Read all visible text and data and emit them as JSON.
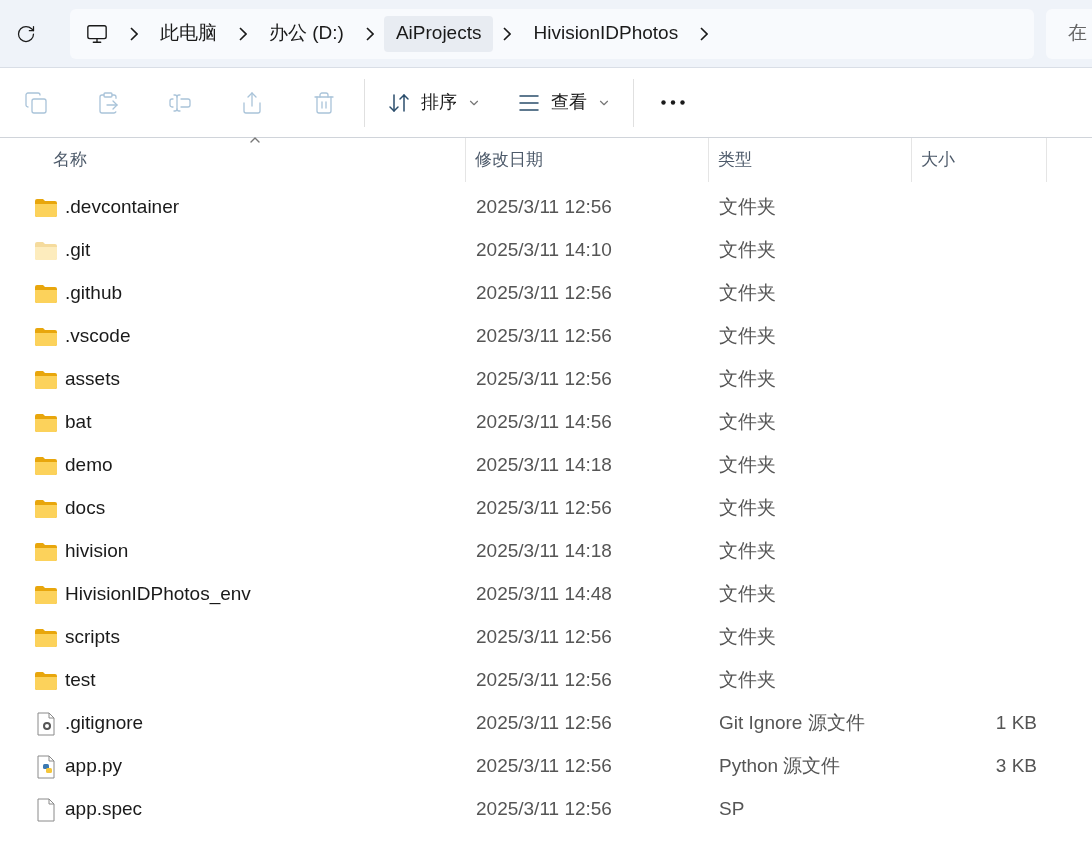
{
  "address_bar": {
    "crumbs": [
      {
        "label": "此电脑",
        "highlighted": false
      },
      {
        "label": "办公 (D:)",
        "highlighted": false
      },
      {
        "label": "AiProjects",
        "highlighted": true
      },
      {
        "label": "HivisionIDPhotos",
        "highlighted": false
      }
    ]
  },
  "search": {
    "placeholder": "在"
  },
  "toolbar": {
    "icon_buttons": [
      {
        "kind": "copy",
        "disabled": true
      },
      {
        "kind": "paste",
        "disabled": true
      },
      {
        "kind": "rename",
        "disabled": true
      },
      {
        "kind": "share",
        "disabled": true
      },
      {
        "kind": "delete",
        "disabled": true
      }
    ],
    "menus": [
      {
        "kind": "sort",
        "label": "排序"
      },
      {
        "kind": "view",
        "label": "查看"
      }
    ]
  },
  "table": {
    "columns": [
      {
        "label": "名称",
        "sorted": true
      },
      {
        "label": "修改日期",
        "sorted": false
      },
      {
        "label": "类型",
        "sorted": false
      },
      {
        "label": "大小",
        "sorted": false
      }
    ],
    "rows": [
      {
        "kind": "folder",
        "hidden": false,
        "name": ".devcontainer",
        "date": "2025/3/11 12:56",
        "type": "文件夹"
      },
      {
        "kind": "folder",
        "hidden": true,
        "name": ".git",
        "date": "2025/3/11 14:10",
        "type": "文件夹"
      },
      {
        "kind": "folder",
        "hidden": false,
        "name": ".github",
        "date": "2025/3/11 12:56",
        "type": "文件夹"
      },
      {
        "kind": "folder",
        "hidden": false,
        "name": ".vscode",
        "date": "2025/3/11 12:56",
        "type": "文件夹"
      },
      {
        "kind": "folder",
        "hidden": false,
        "name": "assets",
        "date": "2025/3/11 12:56",
        "type": "文件夹"
      },
      {
        "kind": "folder",
        "hidden": false,
        "name": "bat",
        "date": "2025/3/11 14:56",
        "type": "文件夹"
      },
      {
        "kind": "folder",
        "hidden": false,
        "name": "demo",
        "date": "2025/3/11 14:18",
        "type": "文件夹"
      },
      {
        "kind": "folder",
        "hidden": false,
        "name": "docs",
        "date": "2025/3/11 12:56",
        "type": "文件夹"
      },
      {
        "kind": "folder",
        "hidden": false,
        "name": "hivision",
        "date": "2025/3/11 14:18",
        "type": "文件夹"
      },
      {
        "kind": "folder",
        "hidden": false,
        "name": "HivisionIDPhotos_env",
        "date": "2025/3/11 14:48",
        "type": "文件夹"
      },
      {
        "kind": "folder",
        "hidden": false,
        "name": "scripts",
        "date": "2025/3/11 12:56",
        "type": "文件夹"
      },
      {
        "kind": "folder",
        "hidden": false,
        "name": "test",
        "date": "2025/3/11 12:56",
        "type": "文件夹"
      },
      {
        "kind": "config",
        "hidden": false,
        "name": ".gitignore",
        "date": "2025/3/11 12:56",
        "type": "Git Ignore 源文件",
        "size": "1 KB"
      },
      {
        "kind": "python",
        "hidden": false,
        "name": "app.py",
        "date": "2025/3/11 12:56",
        "type": "Python 源文件",
        "size": "3 KB"
      },
      {
        "kind": "file",
        "hidden": false,
        "name": "app.spec",
        "date": "2025/3/11 12:56",
        "type": "SP"
      }
    ]
  }
}
